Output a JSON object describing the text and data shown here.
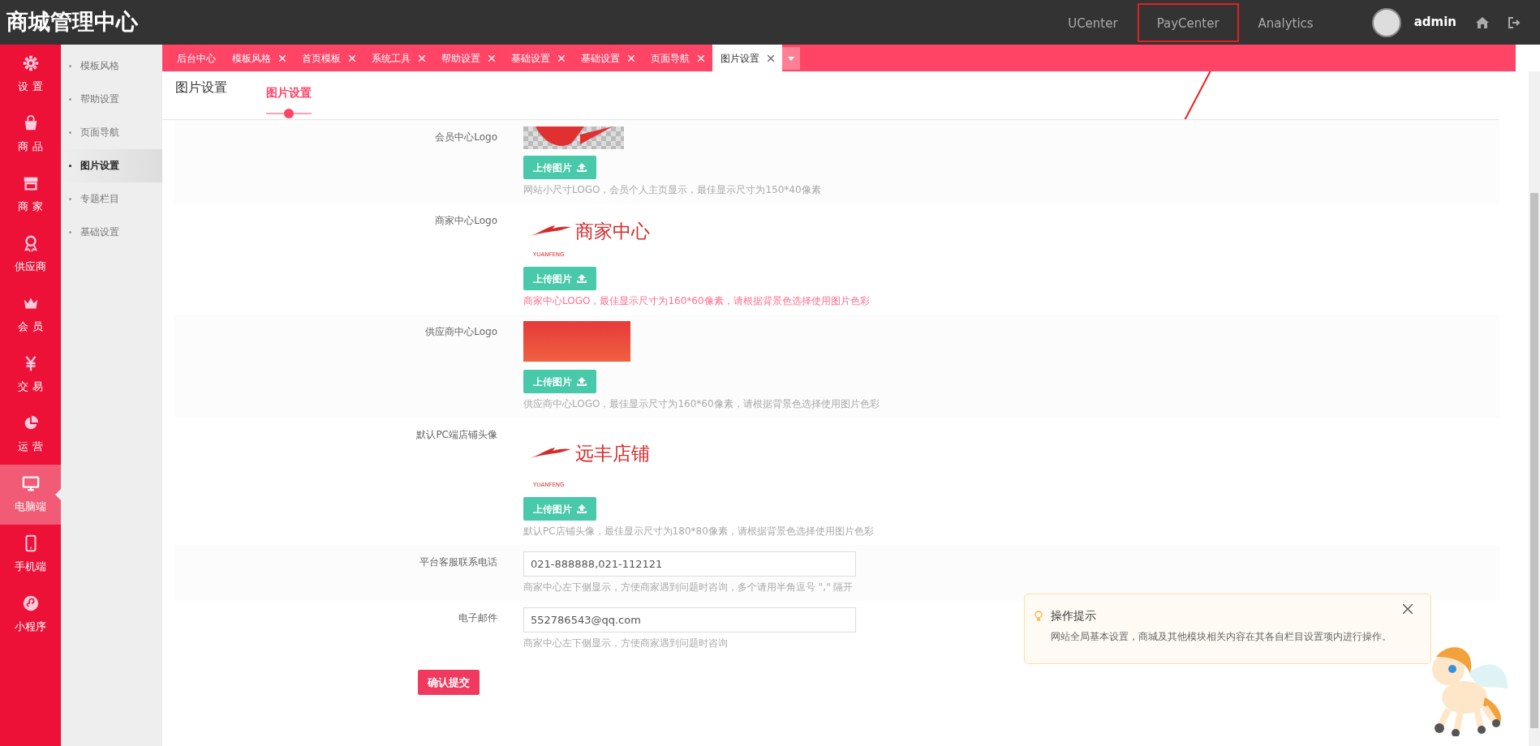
{
  "header": {
    "title": "商城管理中心",
    "user": "admin",
    "nav": [
      {
        "label": "UCenter",
        "highlighted": false
      },
      {
        "label": "PayCenter",
        "highlighted": true
      },
      {
        "label": "Analytics",
        "highlighted": false
      }
    ]
  },
  "sidebar": [
    {
      "kind": "gear",
      "label": "设 置",
      "selected": false
    },
    {
      "kind": "bag",
      "label": "商 品",
      "selected": false
    },
    {
      "kind": "store",
      "label": "商 家",
      "selected": false
    },
    {
      "kind": "medal",
      "label": "供应商",
      "selected": false
    },
    {
      "kind": "crown",
      "label": "会 员",
      "selected": false
    },
    {
      "kind": "yen",
      "label": "交 易",
      "selected": false
    },
    {
      "kind": "pie",
      "label": "运 营",
      "selected": false
    },
    {
      "kind": "monitor",
      "label": "电脑端",
      "selected": true
    },
    {
      "kind": "phone",
      "label": "手机端",
      "selected": false
    },
    {
      "kind": "mini",
      "label": "小程序",
      "selected": false
    }
  ],
  "submenu": [
    {
      "label": "模板风格",
      "selected": false
    },
    {
      "label": "帮助设置",
      "selected": false
    },
    {
      "label": "页面导航",
      "selected": false
    },
    {
      "label": "图片设置",
      "selected": true
    },
    {
      "label": "专题栏目",
      "selected": false
    },
    {
      "label": "基础设置",
      "selected": false
    }
  ],
  "tabs": [
    {
      "label": "后台中心",
      "closable": false,
      "selected": false
    },
    {
      "label": "模板风格",
      "closable": true,
      "selected": false
    },
    {
      "label": "首页模板",
      "closable": true,
      "selected": false
    },
    {
      "label": "系统工具",
      "closable": true,
      "selected": false
    },
    {
      "label": "帮助设置",
      "closable": true,
      "selected": false
    },
    {
      "label": "基础设置",
      "closable": true,
      "selected": false
    },
    {
      "label": "基础设置",
      "closable": true,
      "selected": false
    },
    {
      "label": "页面导航",
      "closable": true,
      "selected": false
    },
    {
      "label": "图片设置",
      "closable": true,
      "selected": true
    }
  ],
  "page": {
    "title": "图片设置",
    "section_tabs": [
      {
        "label": "图片设置",
        "selected": true
      }
    ]
  },
  "fields": [
    {
      "kind": "image",
      "label": "会员中心Logo",
      "image": {
        "kind": "cropped-logo"
      },
      "button": "上传图片",
      "hint": "网站小尺寸LOGO，会员个人主页显示，最佳显示尺寸为150*40像素",
      "hint_alert": false
    },
    {
      "kind": "image",
      "label": "商家中心Logo",
      "image": {
        "kind": "logo",
        "brand": "YUANFENG",
        "text": "商家中心"
      },
      "button": "上传图片",
      "hint": "商家中心LOGO，最佳显示尺寸为160*60像素，请根据背景色选择使用图片色彩",
      "hint_alert": true
    },
    {
      "kind": "image",
      "label": "供应商中心Logo",
      "image": {
        "kind": "illustration"
      },
      "button": "上传图片",
      "hint": "供应商中心LOGO，最佳显示尺寸为160*60像素，请根据背景色选择使用图片色彩",
      "hint_alert": false
    },
    {
      "kind": "image",
      "label": "默认PC端店铺头像",
      "image": {
        "kind": "logo",
        "brand": "YUANFENG",
        "text": "远丰店铺"
      },
      "button": "上传图片",
      "hint": "默认PC店铺头像，最佳显示尺寸为180*80像素，请根据背景色选择使用图片色彩",
      "hint_alert": false
    },
    {
      "kind": "text",
      "label": "平台客服联系电话",
      "value": "021-888888,021-112121",
      "hint": "商家中心左下侧显示，方便商家遇到问题时咨询，多个请用半角逗号 \",\" 隔开"
    },
    {
      "kind": "text",
      "label": "电子邮件",
      "value": "552786543@qq.com",
      "hint": "商家中心左下侧显示，方便商家遇到问题时咨询"
    }
  ],
  "submit": "确认提交",
  "tip": {
    "title": "操作提示",
    "text": "网站全局基本设置，商城及其他模块相关内容在其各自栏目设置项内进行操作。"
  }
}
